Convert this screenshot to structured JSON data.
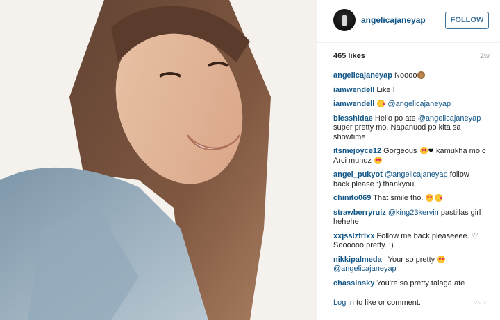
{
  "post": {
    "image_alt": "Selfie of a smiling young woman with long brown hair and a denim shirt"
  },
  "header": {
    "username": "angelicajaneyap",
    "follow_label": "FOLLOW"
  },
  "stats": {
    "likes": "465 likes",
    "time": "2w"
  },
  "comments": [
    {
      "user": "angelicajaneyap",
      "parts": [
        {
          "t": " Noooo"
        },
        {
          "emoji": "monkey"
        }
      ]
    },
    {
      "user": "iamwendell",
      "parts": [
        {
          "t": " Like !"
        }
      ]
    },
    {
      "user": "iamwendell",
      "parts": [
        {
          "t": " "
        },
        {
          "emoji": "kiss"
        },
        {
          "t": " "
        },
        {
          "mention": "@angelicajaneyap"
        }
      ]
    },
    {
      "user": "blesshidae",
      "parts": [
        {
          "t": " Hello po ate "
        },
        {
          "mention": "@angelicajaneyap"
        },
        {
          "t": " super pretty mo. Napanuod po kita sa showtime"
        }
      ]
    },
    {
      "user": "itsmejoyce12",
      "parts": [
        {
          "t": " Gorgeous "
        },
        {
          "emoji": "heart-eyes"
        },
        {
          "heart": "❤"
        },
        {
          "t": " kamukha mo c Arci munoz "
        },
        {
          "emoji": "heart-eyes"
        }
      ]
    },
    {
      "user": "angel_pukyot",
      "parts": [
        {
          "t": " "
        },
        {
          "mention": "@angelicajaneyap"
        },
        {
          "t": " follow back please :) thankyou"
        }
      ]
    },
    {
      "user": "chinito069",
      "parts": [
        {
          "t": " That smile tho. "
        },
        {
          "emoji": "heart-eyes"
        },
        {
          "emoji": "kiss"
        }
      ]
    },
    {
      "user": "strawberryruiz",
      "parts": [
        {
          "t": " "
        },
        {
          "mention": "@king23kervin"
        },
        {
          "t": " pastillas girl hehehe"
        }
      ]
    },
    {
      "user": "xxjsslzfrlxx",
      "parts": [
        {
          "t": " Follow me back pleaseeee. ♡ Soooooo pretty. :)"
        }
      ]
    },
    {
      "user": "nikkipalmeda_",
      "parts": [
        {
          "t": "  Your so pretty "
        },
        {
          "emoji": "heart-eyes"
        },
        {
          "t": " "
        },
        {
          "mention": "@angelicajaneyap"
        }
      ]
    },
    {
      "user": "chassinsky",
      "parts": [
        {
          "t": " You're so pretty talaga ate"
        }
      ]
    }
  ],
  "footer": {
    "login_link": "Log in",
    "login_rest": " to like or comment.",
    "more_icon": "ellipsis-icon",
    "more_glyph": "○○○"
  },
  "colors": {
    "link_blue": "#125688",
    "follow_blue": "#3f729b",
    "muted": "#a5a7aa"
  }
}
